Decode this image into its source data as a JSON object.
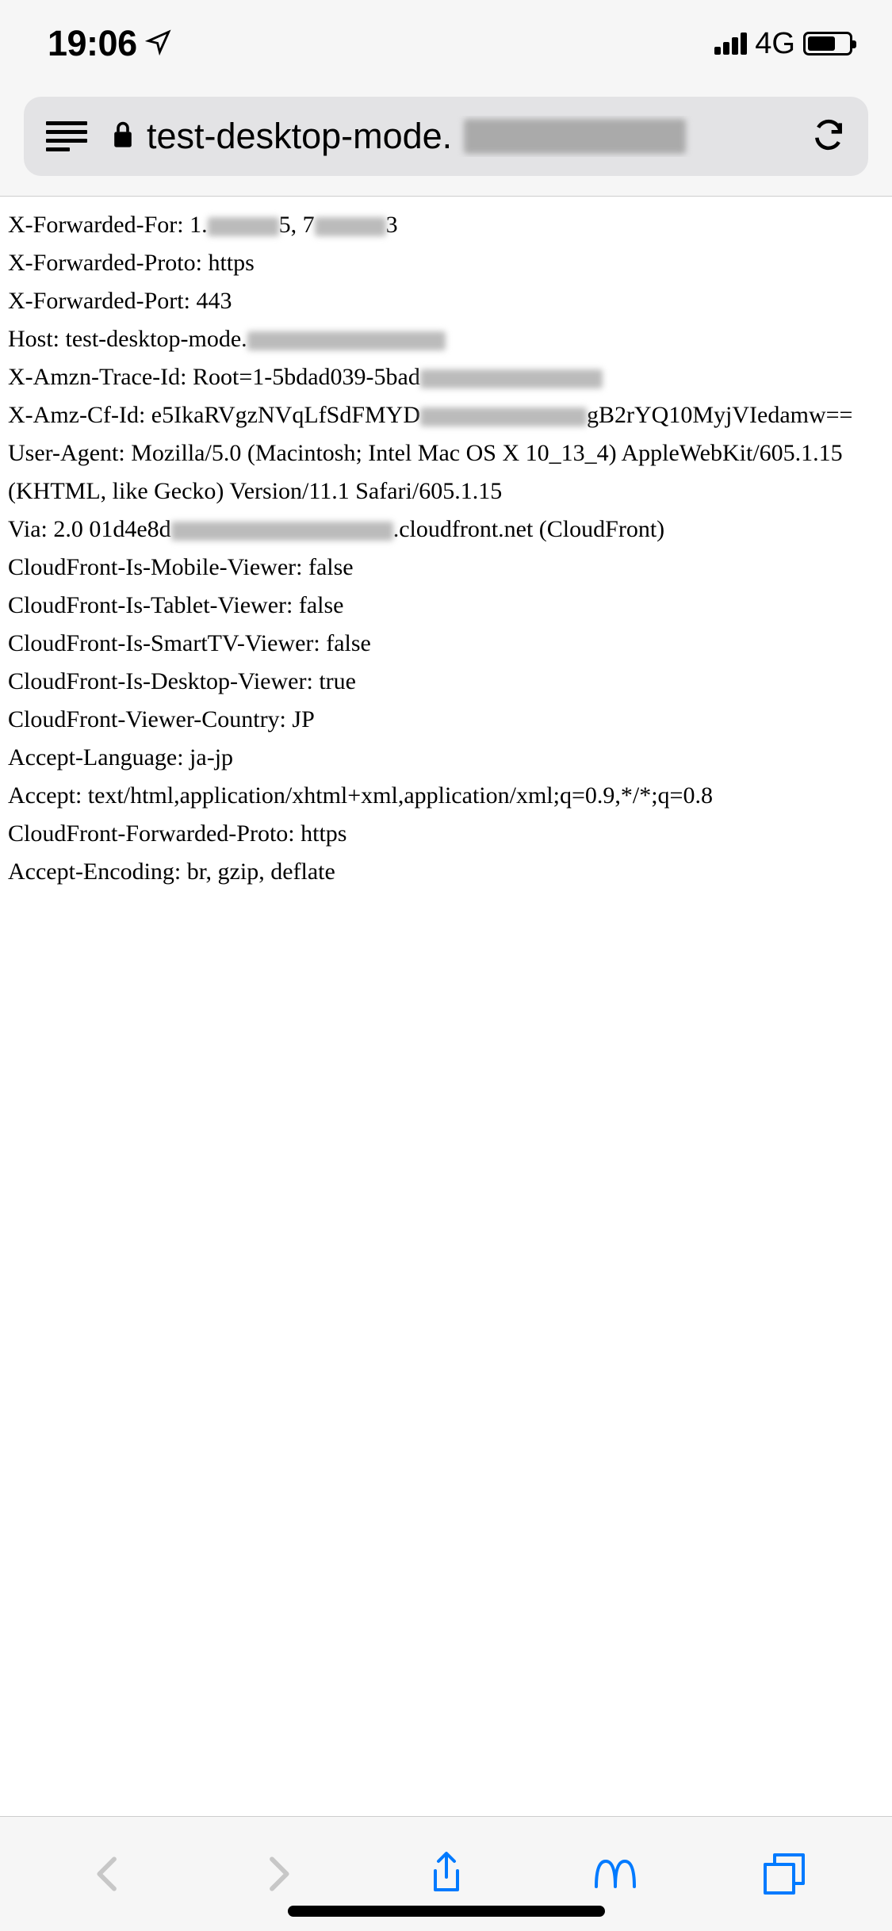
{
  "status_bar": {
    "time": "19:06",
    "network_type": "4G"
  },
  "address_bar": {
    "url_visible": "test-desktop-mode."
  },
  "headers": [
    {
      "label": "X-Forwarded-For:",
      "value_prefix": "1.",
      "redacted1_width": 90,
      "value_mid": "5, 7",
      "redacted2_width": 90,
      "value_suffix": "3"
    },
    {
      "label": "X-Forwarded-Proto:",
      "value": "https"
    },
    {
      "label": "X-Forwarded-Port:",
      "value": "443"
    },
    {
      "label": "Host:",
      "value_prefix": "test-desktop-mode.",
      "redacted1_width": 250
    },
    {
      "label": "X-Amzn-Trace-Id:",
      "value_prefix": "Root=1-5bdad039-5bad",
      "redacted1_width": 230
    },
    {
      "label": "X-Amz-Cf-Id:",
      "value_prefix": "e5IkaRVgzNVqLfSdFMYD",
      "redacted1_width": 210,
      "value_suffix": "gB2rYQ10MyjVIedamw=="
    },
    {
      "label": "User-Agent:",
      "value": "Mozilla/5.0 (Macintosh; Intel Mac OS X 10_13_4) AppleWebKit/605.1.15 (KHTML, like Gecko) Version/11.1 Safari/605.1.15"
    },
    {
      "label": "Via:",
      "value_prefix": "2.0 01d4e8d",
      "redacted1_width": 280,
      "value_suffix": ".cloudfront.net (CloudFront)"
    },
    {
      "label": "CloudFront-Is-Mobile-Viewer:",
      "value": "false"
    },
    {
      "label": "CloudFront-Is-Tablet-Viewer:",
      "value": "false"
    },
    {
      "label": "CloudFront-Is-SmartTV-Viewer:",
      "value": "false"
    },
    {
      "label": "CloudFront-Is-Desktop-Viewer:",
      "value": "true"
    },
    {
      "label": "CloudFront-Viewer-Country:",
      "value": "JP"
    },
    {
      "label": "Accept-Language:",
      "value": "ja-jp"
    },
    {
      "label": "Accept:",
      "value": "text/html,application/xhtml+xml,application/xml;q=0.9,*/*;q=0.8"
    },
    {
      "label": "CloudFront-Forwarded-Proto:",
      "value": "https"
    },
    {
      "label": "Accept-Encoding:",
      "value": "br, gzip, deflate"
    }
  ]
}
